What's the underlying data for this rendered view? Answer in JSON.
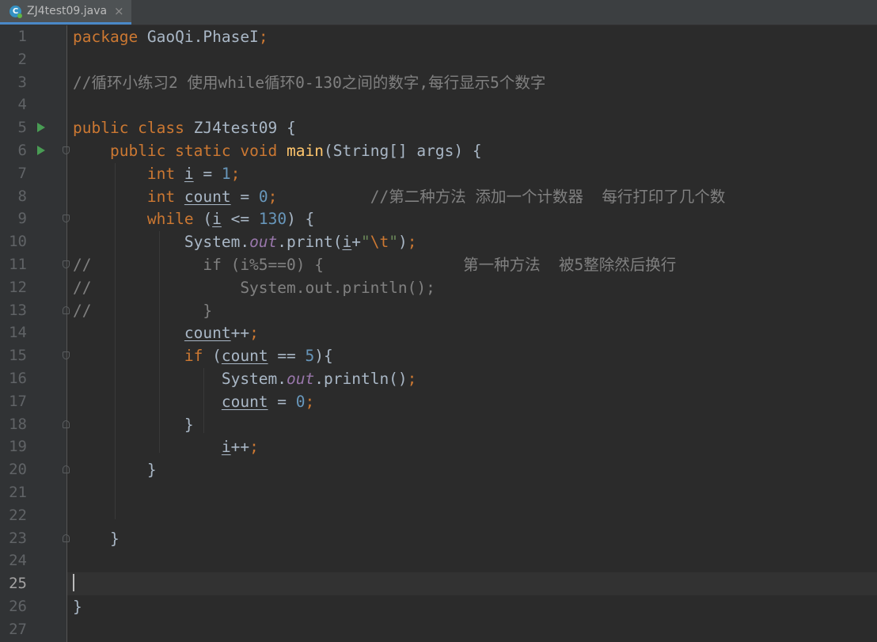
{
  "tab": {
    "icon_letter": "C",
    "filename": "ZJ4test09.java",
    "close_glyph": "×"
  },
  "editor": {
    "current_line": 25,
    "lines": [
      {
        "n": "1",
        "tokens": [
          [
            "kw",
            "package "
          ],
          [
            "",
            "GaoQi.PhaseI"
          ],
          [
            "kw",
            ";"
          ]
        ]
      },
      {
        "n": "2",
        "tokens": []
      },
      {
        "n": "3",
        "tokens": [
          [
            "cmt",
            "//循环小练习2 使用while循环0-130之间的数字,每行显示5个数字"
          ]
        ]
      },
      {
        "n": "4",
        "tokens": []
      },
      {
        "n": "5",
        "run": true,
        "tokens": [
          [
            "kw",
            "public class "
          ],
          [
            "",
            "ZJ4test09 {"
          ]
        ]
      },
      {
        "n": "6",
        "run": true,
        "fold": "start",
        "tokens": [
          [
            "",
            "    "
          ],
          [
            "kw",
            "public static void "
          ],
          [
            "fn",
            "main"
          ],
          [
            "",
            "(String[] args) {"
          ]
        ]
      },
      {
        "n": "7",
        "tokens": [
          [
            "",
            "        "
          ],
          [
            "kw",
            "int "
          ],
          [
            "var",
            "i"
          ],
          [
            "",
            " = "
          ],
          [
            "num",
            "1"
          ],
          [
            "kw",
            ";"
          ]
        ]
      },
      {
        "n": "8",
        "tokens": [
          [
            "",
            "        "
          ],
          [
            "kw",
            "int "
          ],
          [
            "var",
            "count"
          ],
          [
            "",
            " = "
          ],
          [
            "num",
            "0"
          ],
          [
            "kw",
            ";"
          ],
          [
            "",
            "          "
          ],
          [
            "cmt",
            "//第二种方法 添加一个计数器  每行打印了几个数"
          ]
        ]
      },
      {
        "n": "9",
        "fold": "start",
        "tokens": [
          [
            "",
            "        "
          ],
          [
            "kw",
            "while "
          ],
          [
            "",
            "("
          ],
          [
            "var",
            "i"
          ],
          [
            "",
            " <= "
          ],
          [
            "num",
            "130"
          ],
          [
            "",
            ") {"
          ]
        ]
      },
      {
        "n": "10",
        "tokens": [
          [
            "",
            "            System."
          ],
          [
            "fld",
            "out"
          ],
          [
            "",
            ".print("
          ],
          [
            "var",
            "i"
          ],
          [
            "",
            "+"
          ],
          [
            "str",
            "\""
          ],
          [
            "esc",
            "\\t"
          ],
          [
            "str",
            "\""
          ],
          [
            "",
            ")"
          ],
          [
            "kw",
            ";"
          ]
        ]
      },
      {
        "n": "11",
        "fold": "start",
        "tokens": [
          [
            "cmt",
            "//            if (i%5==0) {               第一种方法  被5整除然后换行"
          ]
        ]
      },
      {
        "n": "12",
        "tokens": [
          [
            "cmt",
            "//                System.out.println();"
          ]
        ]
      },
      {
        "n": "13",
        "fold": "end",
        "tokens": [
          [
            "cmt",
            "//            }"
          ]
        ]
      },
      {
        "n": "14",
        "tokens": [
          [
            "",
            "            "
          ],
          [
            "var",
            "count"
          ],
          [
            "",
            "++"
          ],
          [
            "kw",
            ";"
          ]
        ]
      },
      {
        "n": "15",
        "fold": "start",
        "tokens": [
          [
            "",
            "            "
          ],
          [
            "kw",
            "if "
          ],
          [
            "",
            "("
          ],
          [
            "var",
            "count"
          ],
          [
            "",
            " == "
          ],
          [
            "num",
            "5"
          ],
          [
            "",
            "){"
          ]
        ]
      },
      {
        "n": "16",
        "tokens": [
          [
            "",
            "                System."
          ],
          [
            "fld",
            "out"
          ],
          [
            "",
            ".println()"
          ],
          [
            "kw",
            ";"
          ]
        ]
      },
      {
        "n": "17",
        "tokens": [
          [
            "",
            "                "
          ],
          [
            "var",
            "count"
          ],
          [
            "",
            " = "
          ],
          [
            "num",
            "0"
          ],
          [
            "kw",
            ";"
          ]
        ]
      },
      {
        "n": "18",
        "fold": "end",
        "tokens": [
          [
            "",
            "            }"
          ]
        ]
      },
      {
        "n": "19",
        "tokens": [
          [
            "",
            "                "
          ],
          [
            "var",
            "i"
          ],
          [
            "",
            "++"
          ],
          [
            "kw",
            ";"
          ]
        ]
      },
      {
        "n": "20",
        "fold": "end",
        "tokens": [
          [
            "",
            "        }"
          ]
        ]
      },
      {
        "n": "21",
        "tokens": []
      },
      {
        "n": "22",
        "tokens": []
      },
      {
        "n": "23",
        "fold": "end",
        "tokens": [
          [
            "",
            "    }"
          ]
        ]
      },
      {
        "n": "24",
        "tokens": []
      },
      {
        "n": "25",
        "tokens": []
      },
      {
        "n": "26",
        "tokens": [
          [
            "",
            "}"
          ]
        ]
      },
      {
        "n": "27",
        "tokens": []
      }
    ]
  },
  "colors": {
    "background": "#2b2b2b",
    "gutter": "#313335",
    "keyword": "#cc7832",
    "number": "#6897bb",
    "comment": "#808080",
    "method": "#ffc66d",
    "static_field": "#9876aa",
    "string": "#6a8759",
    "default_text": "#a9b7c6",
    "run_icon": "#499c54",
    "tab_underline": "#4a88c7"
  }
}
